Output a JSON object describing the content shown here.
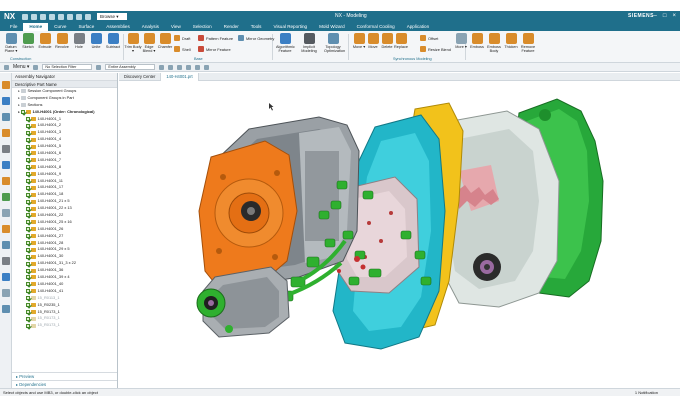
{
  "app": {
    "logo": "NX",
    "title": "NX - Modeling",
    "brand": "SIEMENS",
    "qat_select": "Browse ▾"
  },
  "tabs": [
    "File",
    "Home",
    "Curve",
    "Surface",
    "Assemblies",
    "Analysis",
    "View",
    "Selection",
    "Render",
    "Tools",
    "Visual Reporting",
    "Mold Wizard",
    "Conformal Cooling",
    "Application"
  ],
  "ribbon": {
    "construction": [
      {
        "label": "Datum Plane ▾",
        "color": "#5f8fb0"
      },
      {
        "label": "Sketch",
        "color": "#4f9c4f"
      },
      {
        "label": "Extrude",
        "color": "#d98c2b"
      },
      {
        "label": "Revolve",
        "color": "#d98c2b"
      },
      {
        "label": "Hole",
        "color": "#7a7f85"
      },
      {
        "label": "Unite",
        "color": "#3b7fc4"
      },
      {
        "label": "Subtract",
        "color": "#3b7fc4"
      }
    ],
    "base": [
      {
        "label": "Trim Body ▾",
        "color": "#d98c2b"
      },
      {
        "label": "Edge Blend ▾",
        "color": "#d98c2b"
      },
      {
        "label": "Chamfer",
        "color": "#d98c2b"
      }
    ],
    "small": [
      {
        "label": "Draft",
        "color": "#d98c2b"
      },
      {
        "label": "Shell",
        "color": "#d98c2b"
      },
      {
        "label": "Pattern Feature",
        "color": "#c94b3a"
      },
      {
        "label": "Mirror Feature",
        "color": "#c94b3a"
      },
      {
        "label": "Mirror Geometry",
        "color": "#5f8fb0"
      }
    ],
    "optimize": [
      {
        "label": "Algorithmic Feature",
        "color": "#3b7fc4"
      },
      {
        "label": "Implicit Modeling",
        "color": "#555a60"
      },
      {
        "label": "Topology Optimization",
        "color": "#5f8fb0"
      }
    ],
    "sync": [
      {
        "label": "Move ▾",
        "color": "#d98c2b"
      },
      {
        "label": "Move",
        "color": "#d98c2b"
      },
      {
        "label": "Delete",
        "color": "#d98c2b"
      },
      {
        "label": "Replace",
        "color": "#d98c2b"
      },
      {
        "label": "Offset",
        "color": "#d98c2b"
      },
      {
        "label": "Resize Blend",
        "color": "#d98c2b"
      },
      {
        "label": "More ▾",
        "color": "#8aa3b3"
      }
    ],
    "emboss": [
      {
        "label": "Emboss",
        "color": "#d98c2b"
      },
      {
        "label": "Emboss Body",
        "color": "#d98c2b"
      },
      {
        "label": "Thicken",
        "color": "#d98c2b"
      },
      {
        "label": "Remove Feature",
        "color": "#d98c2b"
      }
    ],
    "groups": {
      "construction": "Construction",
      "base": "Base",
      "sync": "Synchronous Modeling"
    }
  },
  "selbar": {
    "menu": "Menu ▾",
    "filter": "No Selection Filter",
    "scope": "Entire Assembly"
  },
  "navigator": {
    "title": "Assembly Navigator",
    "column": "Descriptive Part Name",
    "rows": [
      {
        "label": "Session Component Groups",
        "type": "folder",
        "indent": 1
      },
      {
        "label": "Component Groups in Part",
        "type": "folder",
        "indent": 1
      },
      {
        "label": "Sections",
        "type": "folder",
        "indent": 1
      },
      {
        "label": "140-H4001 (Order: Chronological)",
        "type": "root",
        "indent": 1
      },
      {
        "label": "140-H4001_1",
        "type": "part",
        "indent": 2
      },
      {
        "label": "140-H4001_2",
        "type": "part",
        "indent": 2
      },
      {
        "label": "140-H4001_3",
        "type": "part",
        "indent": 2
      },
      {
        "label": "140-H4001_4",
        "type": "part",
        "indent": 2
      },
      {
        "label": "140-H4001_5",
        "type": "part",
        "indent": 2
      },
      {
        "label": "140-H4001_6",
        "type": "part",
        "indent": 2
      },
      {
        "label": "140-H4001_7",
        "type": "part",
        "indent": 2
      },
      {
        "label": "140-H4001_8",
        "type": "part",
        "indent": 2
      },
      {
        "label": "140-H4001_9",
        "type": "part",
        "indent": 2
      },
      {
        "label": "140-H4001_11",
        "type": "part",
        "indent": 2
      },
      {
        "label": "140-H4001_17",
        "type": "part",
        "indent": 2
      },
      {
        "label": "140-H4001_18",
        "type": "part",
        "indent": 2
      },
      {
        "label": "140-H4001_21 x 5",
        "type": "part",
        "indent": 2
      },
      {
        "label": "140-H4001_22 x 13",
        "type": "part",
        "indent": 2
      },
      {
        "label": "140-H4001_22",
        "type": "part",
        "indent": 2
      },
      {
        "label": "140-H4001_25 x 16",
        "type": "part",
        "indent": 2
      },
      {
        "label": "140-H4001_26",
        "type": "part",
        "indent": 2
      },
      {
        "label": "140-H4001_27",
        "type": "part",
        "indent": 2
      },
      {
        "label": "140-H4001_28",
        "type": "part",
        "indent": 2
      },
      {
        "label": "140-H4001_29 x 5",
        "type": "part",
        "indent": 2
      },
      {
        "label": "140-H4001_30",
        "type": "part",
        "indent": 2
      },
      {
        "label": "140-H4001_31_3 x 22",
        "type": "part",
        "indent": 2
      },
      {
        "label": "140-H4001_36",
        "type": "part",
        "indent": 2
      },
      {
        "label": "140-H4001_39 x 4",
        "type": "part",
        "indent": 2
      },
      {
        "label": "140-H4001_40",
        "type": "part",
        "indent": 2
      },
      {
        "label": "140-H4001_41",
        "type": "part",
        "indent": 2
      },
      {
        "label": "15_R0113_1",
        "type": "grey",
        "indent": 2
      },
      {
        "label": "15_R0235_1",
        "type": "part",
        "indent": 2
      },
      {
        "label": "15_R0173_1",
        "type": "part",
        "indent": 2
      },
      {
        "label": "15_R0173_1",
        "type": "grey",
        "indent": 2
      },
      {
        "label": "15_R0173_1",
        "type": "grey",
        "indent": 2
      }
    ],
    "preview": "Preview",
    "dependencies": "Dependencies"
  },
  "graphics_tabs": [
    "Discovery Center",
    "140-H4001.prt"
  ],
  "status": {
    "prompt": "Select objects and use MB3, or double-click an object",
    "notification": "1 Notification"
  },
  "colors": {
    "accent": "#1f6f8b",
    "orange": "#e8731e",
    "green": "#2fb02f",
    "cyan": "#21b6c9",
    "yellow": "#f2c21b",
    "grey": "#8a8f95"
  }
}
